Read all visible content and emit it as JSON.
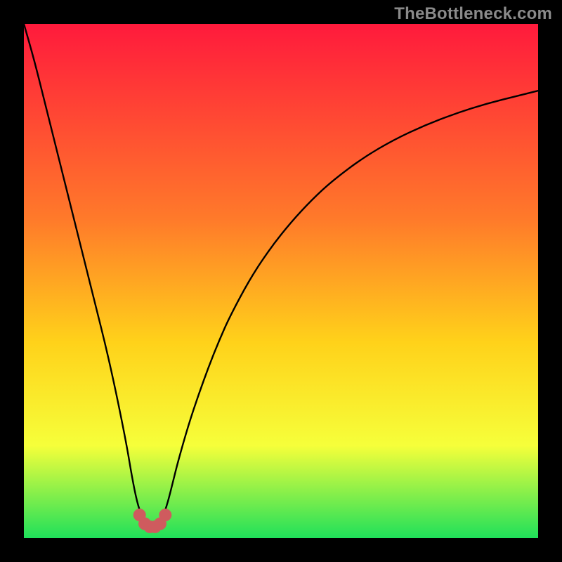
{
  "watermark": "TheBottleneck.com",
  "colors": {
    "frame": "#000000",
    "gradient_top": "#ff1a3c",
    "gradient_mid1": "#ff7a2a",
    "gradient_mid2": "#ffd21a",
    "gradient_mid3": "#f6ff3a",
    "gradient_bottom": "#1fe05a",
    "curve": "#000000",
    "marker": "#cf5b5e"
  },
  "chart_data": {
    "type": "line",
    "title": "",
    "xlabel": "",
    "ylabel": "",
    "xlim": [
      0,
      100
    ],
    "ylim": [
      0,
      100
    ],
    "series": [
      {
        "name": "bottleneck-curve",
        "x": [
          0,
          2,
          4,
          6,
          8,
          10,
          12,
          14,
          16,
          18,
          20,
          21,
          22,
          23,
          24,
          25,
          26,
          27,
          28,
          29,
          30,
          32,
          34,
          36,
          38,
          40,
          44,
          48,
          52,
          56,
          60,
          66,
          72,
          78,
          84,
          90,
          96,
          100
        ],
        "y": [
          100,
          93,
          85,
          77,
          69,
          61,
          53,
          45,
          37,
          28,
          18,
          12,
          7,
          4,
          2.5,
          2,
          2.5,
          4,
          7,
          11,
          15,
          22,
          28,
          33.5,
          38.5,
          43,
          50.5,
          56.5,
          61.5,
          65.8,
          69.5,
          74,
          77.5,
          80.3,
          82.6,
          84.5,
          86,
          87
        ]
      }
    ],
    "markers": {
      "name": "minimum-highlight",
      "x": [
        22.5,
        23.5,
        24.5,
        25.5,
        26.5,
        27.5
      ],
      "y": [
        4.5,
        2.8,
        2.2,
        2.2,
        2.8,
        4.5
      ]
    }
  }
}
